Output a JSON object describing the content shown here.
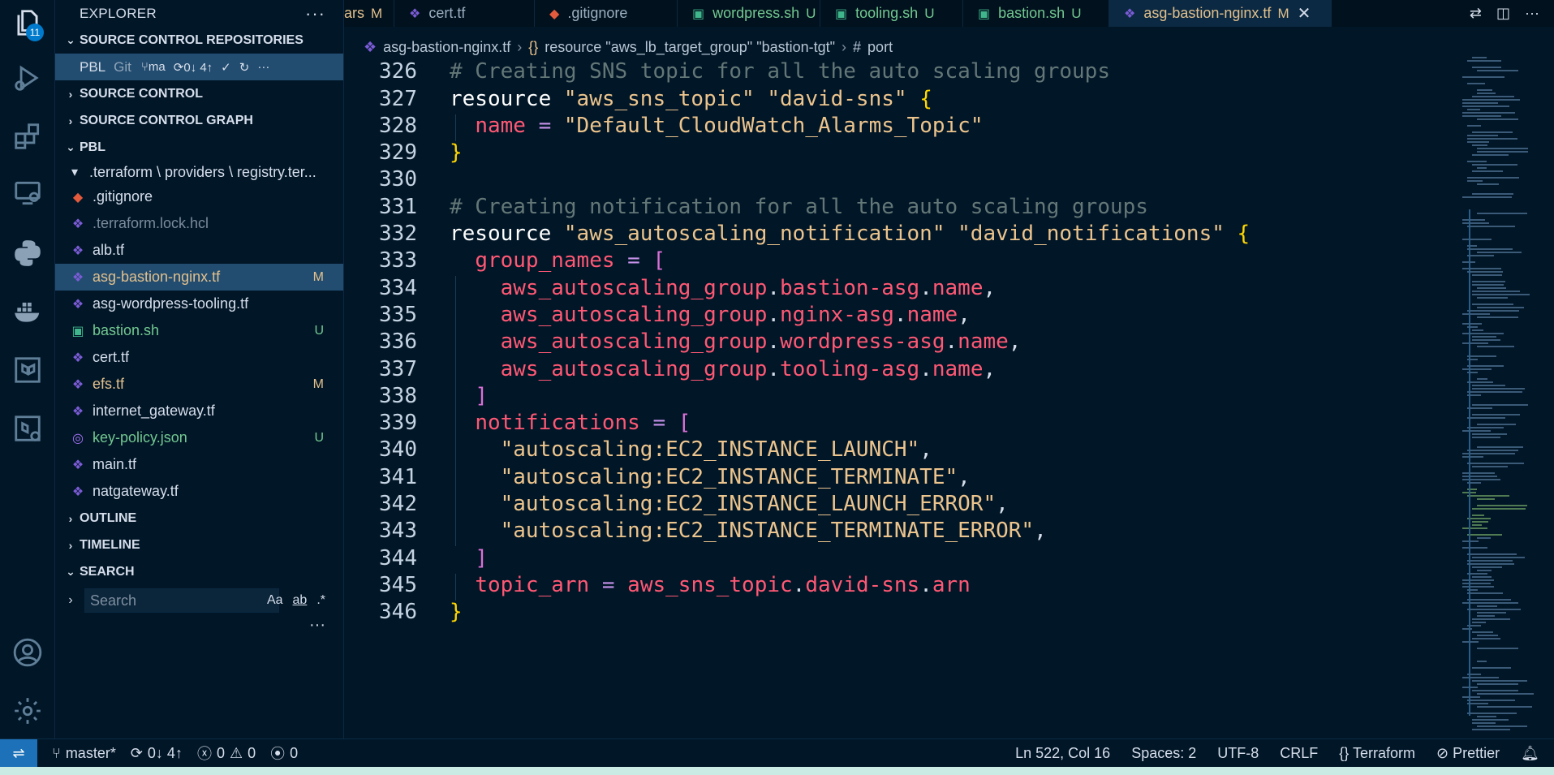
{
  "activity": {
    "badge": "11",
    "icons": [
      "explorer-icon",
      "run-debug-icon",
      "extensions-icon",
      "remote-explorer-icon",
      "python-icon",
      "docker-icon",
      "terraform-icon",
      "terraform-cloud-icon",
      "account-icon",
      "settings-icon"
    ]
  },
  "sidebar": {
    "title": "EXPLORER",
    "sections": {
      "repos": "SOURCE CONTROL REPOSITORIES",
      "source_control": "SOURCE CONTROL",
      "graph": "SOURCE CONTROL GRAPH",
      "pbl": "PBL",
      "outline": "OUTLINE",
      "timeline": "TIMELINE",
      "search": "SEARCH"
    },
    "repo": {
      "name": "PBL",
      "vcs": "Git",
      "branch": "ma",
      "sync": "0↓ 4↑"
    },
    "tree": [
      {
        "name": ".terraform \\ providers \\ registry.ter...",
        "kind": "folder",
        "status": "",
        "color": "default"
      },
      {
        "name": ".gitignore",
        "kind": "git",
        "status": "",
        "color": "default"
      },
      {
        "name": ".terraform.lock.hcl",
        "kind": "tf",
        "status": "",
        "color": "ignored"
      },
      {
        "name": "alb.tf",
        "kind": "tf",
        "status": "",
        "color": "default"
      },
      {
        "name": "asg-bastion-nginx.tf",
        "kind": "tf",
        "status": "M",
        "color": "modified"
      },
      {
        "name": "asg-wordpress-tooling.tf",
        "kind": "tf",
        "status": "",
        "color": "default"
      },
      {
        "name": "bastion.sh",
        "kind": "sh",
        "status": "U",
        "color": "untracked"
      },
      {
        "name": "cert.tf",
        "kind": "tf",
        "status": "",
        "color": "default"
      },
      {
        "name": "efs.tf",
        "kind": "tf",
        "status": "M",
        "color": "modified"
      },
      {
        "name": "internet_gateway.tf",
        "kind": "tf",
        "status": "",
        "color": "default"
      },
      {
        "name": "key-policy.json",
        "kind": "json",
        "status": "U",
        "color": "untracked"
      },
      {
        "name": "main.tf",
        "kind": "tf",
        "status": "",
        "color": "default"
      },
      {
        "name": "natgateway.tf",
        "kind": "tf",
        "status": "",
        "color": "default"
      }
    ],
    "search_placeholder": "Search",
    "search_opts": [
      "Aa",
      "ab",
      ".*"
    ]
  },
  "tabs": [
    {
      "name": "ars",
      "status": "M",
      "kind": "none",
      "active": false
    },
    {
      "name": "cert.tf",
      "status": "",
      "kind": "tf",
      "active": false
    },
    {
      "name": ".gitignore",
      "status": "",
      "kind": "git",
      "active": false
    },
    {
      "name": "wordpress.sh",
      "status": "U",
      "kind": "sh",
      "active": false
    },
    {
      "name": "tooling.sh",
      "status": "U",
      "kind": "sh",
      "active": false
    },
    {
      "name": "bastion.sh",
      "status": "U",
      "kind": "sh",
      "active": false
    },
    {
      "name": "asg-bastion-nginx.tf",
      "status": "M",
      "kind": "tf",
      "active": true
    }
  ],
  "breadcrumb": [
    "asg-bastion-nginx.tf",
    "resource \"aws_lb_target_group\" \"bastion-tgt\"",
    "port"
  ],
  "editor": {
    "lines": [
      {
        "n": "326",
        "text": "# Creating SNS topic for all the auto scaling groups"
      },
      {
        "n": "327",
        "text": "resource \"aws_sns_topic\" \"david-sns\" {"
      },
      {
        "n": "328",
        "text": "  name = \"Default_CloudWatch_Alarms_Topic\""
      },
      {
        "n": "329",
        "text": "}"
      },
      {
        "n": "330",
        "text": ""
      },
      {
        "n": "331",
        "text": "# Creating notification for all the auto scaling groups"
      },
      {
        "n": "332",
        "text": "resource \"aws_autoscaling_notification\" \"david_notifications\" {"
      },
      {
        "n": "333",
        "text": "  group_names = ["
      },
      {
        "n": "334",
        "text": "    aws_autoscaling_group.bastion-asg.name,"
      },
      {
        "n": "335",
        "text": "    aws_autoscaling_group.nginx-asg.name,"
      },
      {
        "n": "336",
        "text": "    aws_autoscaling_group.wordpress-asg.name,"
      },
      {
        "n": "337",
        "text": "    aws_autoscaling_group.tooling-asg.name,"
      },
      {
        "n": "338",
        "text": "  ]"
      },
      {
        "n": "339",
        "text": "  notifications = ["
      },
      {
        "n": "340",
        "text": "    \"autoscaling:EC2_INSTANCE_LAUNCH\","
      },
      {
        "n": "341",
        "text": "    \"autoscaling:EC2_INSTANCE_TERMINATE\","
      },
      {
        "n": "342",
        "text": "    \"autoscaling:EC2_INSTANCE_LAUNCH_ERROR\","
      },
      {
        "n": "343",
        "text": "    \"autoscaling:EC2_INSTANCE_TERMINATE_ERROR\","
      },
      {
        "n": "344",
        "text": "  ]"
      },
      {
        "n": "345",
        "text": "  topic_arn = aws_sns_topic.david-sns.arn"
      },
      {
        "n": "346",
        "text": "}"
      }
    ]
  },
  "status": {
    "branch": "master*",
    "sync": "0↓ 4↑",
    "errors": "0",
    "warnings": "0",
    "ports": "0",
    "cursor": "Ln 522, Col 16",
    "spaces": "Spaces: 2",
    "encoding": "UTF-8",
    "eol": "CRLF",
    "language": "Terraform",
    "formatter": "Prettier"
  },
  "colors": {
    "background": "#011627",
    "accent": "#1d71b8",
    "modified": "#e2c08d",
    "untracked": "#73c991"
  }
}
